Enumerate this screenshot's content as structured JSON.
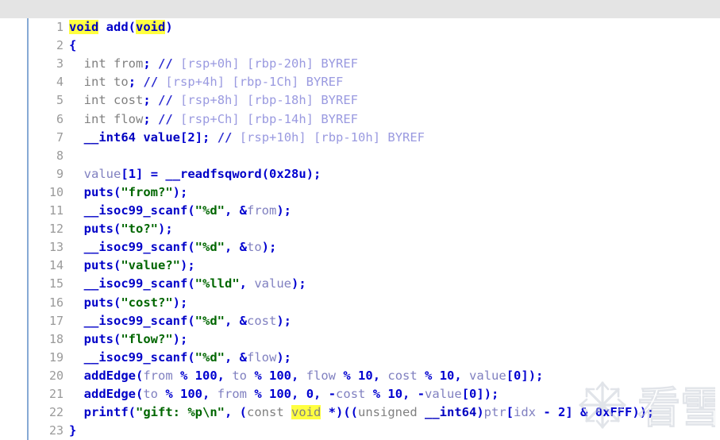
{
  "app": {
    "name": "IDA Pro Hex-Rays Pseudocode",
    "view": "Pseudocode-A",
    "language": "C"
  },
  "editor": {
    "current_line": 1,
    "highlighted_token": "void",
    "total_lines": 23,
    "colors": {
      "background": "#ffffff",
      "current_line_background": "#e4e4e4",
      "line_number": "#9a9a9a",
      "scope_guide": "#86a9d4",
      "keyword": "#0000c0",
      "function": "#0000c8",
      "string": "#006600",
      "number": "#0000d0",
      "local_variable": "#8080c0",
      "type": "#808080",
      "comment": "#9a9ae0",
      "comment_slash": "#2b2bd0",
      "highlight": "#ffff40"
    }
  },
  "lines": [
    {
      "n": "1",
      "text": "void add(void)"
    },
    {
      "n": "2",
      "text": "{"
    },
    {
      "n": "3",
      "text": "  int from; // [rsp+0h] [rbp-20h] BYREF"
    },
    {
      "n": "4",
      "text": "  int to; // [rsp+4h] [rbp-1Ch] BYREF"
    },
    {
      "n": "5",
      "text": "  int cost; // [rsp+8h] [rbp-18h] BYREF"
    },
    {
      "n": "6",
      "text": "  int flow; // [rsp+Ch] [rbp-14h] BYREF"
    },
    {
      "n": "7",
      "text": "  __int64 value[2]; // [rsp+10h] [rbp-10h] BYREF"
    },
    {
      "n": "8",
      "text": ""
    },
    {
      "n": "9",
      "text": "  value[1] = __readfsqword(0x28u);"
    },
    {
      "n": "10",
      "text": "  puts(\"from?\");"
    },
    {
      "n": "11",
      "text": "  __isoc99_scanf(\"%d\", &from);"
    },
    {
      "n": "12",
      "text": "  puts(\"to?\");"
    },
    {
      "n": "13",
      "text": "  __isoc99_scanf(\"%d\", &to);"
    },
    {
      "n": "14",
      "text": "  puts(\"value?\");"
    },
    {
      "n": "15",
      "text": "  __isoc99_scanf(\"%lld\", value);"
    },
    {
      "n": "16",
      "text": "  puts(\"cost?\");"
    },
    {
      "n": "17",
      "text": "  __isoc99_scanf(\"%d\", &cost);"
    },
    {
      "n": "18",
      "text": "  puts(\"flow?\");"
    },
    {
      "n": "19",
      "text": "  __isoc99_scanf(\"%d\", &flow);"
    },
    {
      "n": "20",
      "text": "  addEdge(from % 100, to % 100, flow % 10, cost % 10, value[0]);"
    },
    {
      "n": "21",
      "text": "  addEdge(to % 100, from % 100, 0, -cost % 10, -value[0]);"
    },
    {
      "n": "22",
      "text": "  printf(\"gift: %p\\n\", (const void *)((unsigned __int64)ptr[idx - 2] & 0xFFF));"
    },
    {
      "n": "23",
      "text": "}"
    }
  ],
  "watermark": {
    "icon": "snowflake-icon",
    "text": "看雪"
  }
}
